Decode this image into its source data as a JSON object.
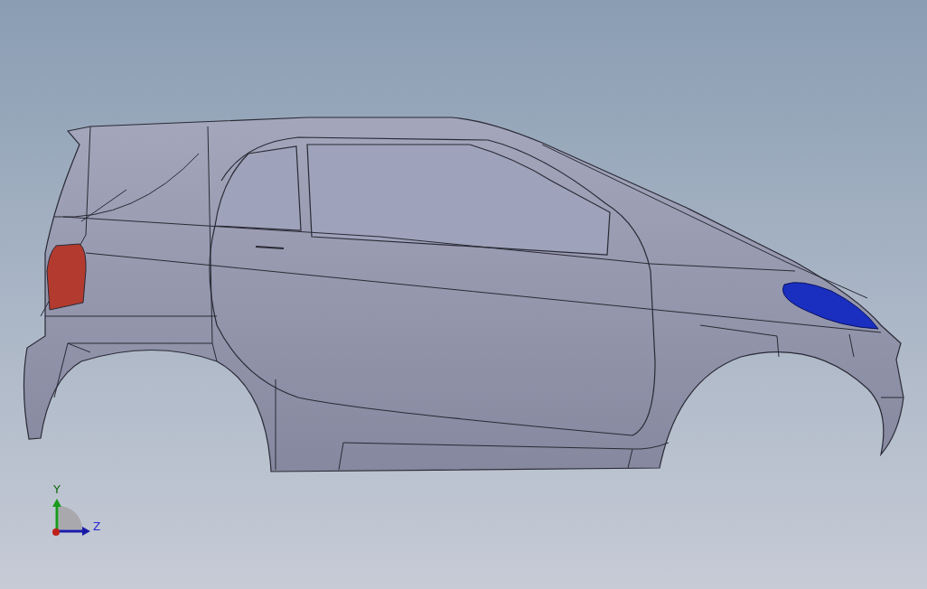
{
  "viewport": {
    "model": {
      "kind": "car-body"
    },
    "triad": {
      "axes": [
        {
          "kind": "vertical",
          "label": "Y",
          "color": "#1a9a1a"
        },
        {
          "kind": "horizontal",
          "label": "Z",
          "color": "#1a1aa8"
        }
      ]
    }
  }
}
